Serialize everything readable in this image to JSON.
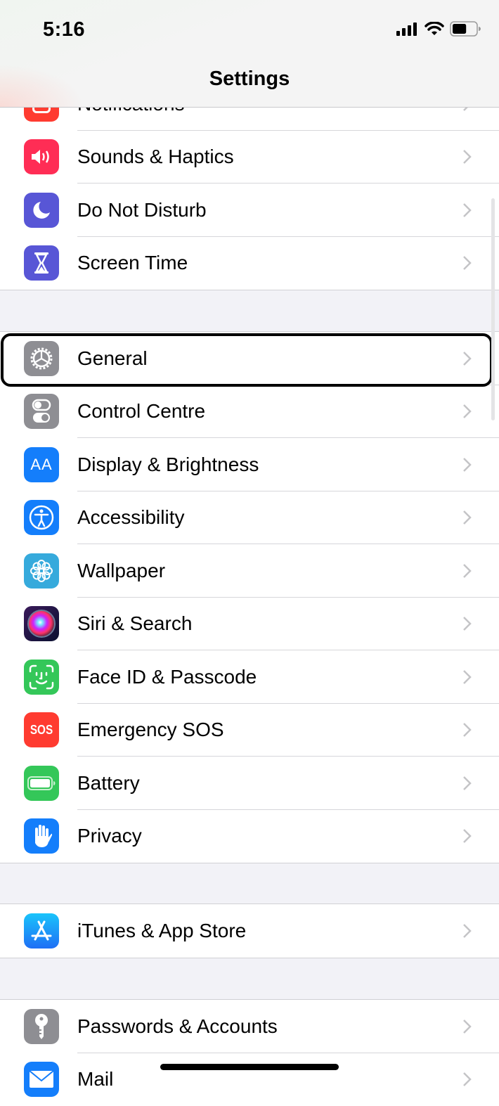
{
  "status_bar": {
    "time": "5:16",
    "signal_icon": "cellular-signal-icon",
    "wifi_icon": "wifi-icon",
    "battery_icon": "battery-icon",
    "battery_level": 0.6
  },
  "header": {
    "title": "Settings"
  },
  "colors": {
    "background": "#f2f2f7",
    "row": "#ffffff",
    "separator": "#d6d6da",
    "chevron": "#c4c4c7",
    "highlight": "#000000"
  },
  "groups": [
    {
      "items": [
        {
          "label": "Notifications",
          "icon": "notifications-icon",
          "color": "#ff3b30"
        },
        {
          "label": "Sounds & Haptics",
          "icon": "speaker-icon",
          "color": "#ff2d55"
        },
        {
          "label": "Do Not Disturb",
          "icon": "moon-icon",
          "color": "#5856d6"
        },
        {
          "label": "Screen Time",
          "icon": "hourglass-icon",
          "color": "#5856d6"
        }
      ]
    },
    {
      "items": [
        {
          "label": "General",
          "icon": "gear-icon",
          "color": "#8e8e93",
          "highlighted": true
        },
        {
          "label": "Control Centre",
          "icon": "toggles-icon",
          "color": "#8e8e93"
        },
        {
          "label": "Display & Brightness",
          "icon": "text-size-icon",
          "icon_text": "AA",
          "color": "#147efb"
        },
        {
          "label": "Accessibility",
          "icon": "accessibility-icon",
          "color": "#147efb"
        },
        {
          "label": "Wallpaper",
          "icon": "flower-icon",
          "color": "#36aadc"
        },
        {
          "label": "Siri & Search",
          "icon": "siri-icon",
          "color": "#1a1a3a"
        },
        {
          "label": "Face ID & Passcode",
          "icon": "face-id-icon",
          "color": "#34c759"
        },
        {
          "label": "Emergency SOS",
          "icon": "sos-icon",
          "icon_text": "SOS",
          "color": "#ff3b30"
        },
        {
          "label": "Battery",
          "icon": "battery-setting-icon",
          "color": "#34c759"
        },
        {
          "label": "Privacy",
          "icon": "hand-icon",
          "color": "#147efb"
        }
      ]
    },
    {
      "items": [
        {
          "label": "iTunes & App Store",
          "icon": "app-store-icon",
          "color": "#1e8cf5"
        }
      ]
    },
    {
      "items": [
        {
          "label": "Passwords & Accounts",
          "icon": "key-icon",
          "color": "#8e8e93"
        },
        {
          "label": "Mail",
          "icon": "mail-icon",
          "color": "#147efb"
        }
      ]
    }
  ]
}
